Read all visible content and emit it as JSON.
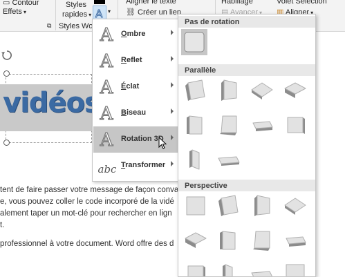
{
  "ribbon": {
    "effets_label": "Effets",
    "styles_label_1": "Styles",
    "styles_label_2": "rapides",
    "group_label": "Styles Wor",
    "aligner_texte": "Aligner le texte",
    "creer_lien": "Créer un lien",
    "habillage": "Habillage",
    "avancer": "Avancer",
    "volet_selection": "Volet Sélection",
    "aligner": "Aligner"
  },
  "document": {
    "wordart_text": "vidéos",
    "lines": [
      "tent de faire passer votre message de façon conva",
      "e, vous pouvez coller le code incorporé de la vidé",
      "alement taper un mot-clé pour rechercher en lign",
      "t.",
      "professionnel à votre document. Word offre des d"
    ]
  },
  "menu": {
    "items": [
      {
        "icon": "A",
        "label": "Ombre",
        "accel": "O",
        "rest": "mbre"
      },
      {
        "icon": "A",
        "label": "Reflet",
        "accel": "R",
        "rest": "eflet"
      },
      {
        "icon": "A",
        "label": "Éclat",
        "accel": "É",
        "rest": "clat"
      },
      {
        "icon": "A",
        "label": "Biseau",
        "accel": "B",
        "rest": "iseau"
      },
      {
        "icon": "A",
        "label": "Rotation 3D",
        "accel": "",
        "rest": "Rotation 3D"
      },
      {
        "icon": "abc",
        "label": "Transformer",
        "accel": "T",
        "rest": "ransformer"
      }
    ],
    "active_index": 4
  },
  "gallery": {
    "sections": [
      {
        "title": "Pas de rotation",
        "tiles": 1
      },
      {
        "title": "Parallèle",
        "tiles": 10
      },
      {
        "title": "Perspective",
        "tiles": 12
      }
    ]
  },
  "colors": {
    "wordart_blue": "#3b6aa3",
    "menu_active": "#c6c6c6",
    "header_bg": "#e8e8e8"
  }
}
